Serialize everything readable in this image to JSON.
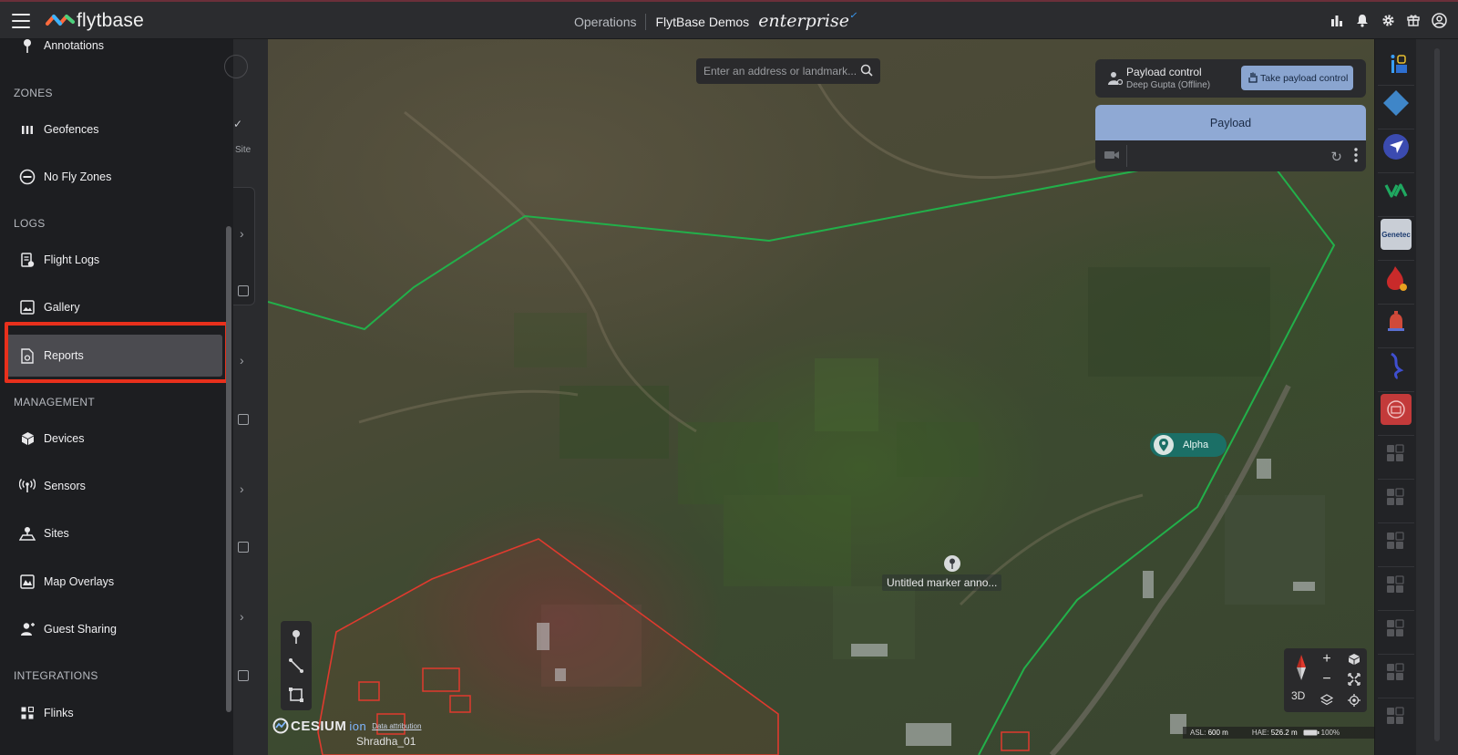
{
  "topbar": {
    "brand": "flytbase",
    "nav_operations": "Operations",
    "organization": "FlytBase Demos",
    "edition": "enterprise",
    "icons": [
      "analytics-icon",
      "bell-icon",
      "gear-icon",
      "gift-icon",
      "user-avatar-icon"
    ]
  },
  "sidebar": {
    "top_item": "Annotations",
    "sections": {
      "zones": "ZONES",
      "logs": "LOGS",
      "management": "MANAGEMENT",
      "integrations": "INTEGRATIONS"
    },
    "items": {
      "geofences": "Geofences",
      "no_fly_zones": "No Fly Zones",
      "flight_logs": "Flight Logs",
      "gallery": "Gallery",
      "reports": "Reports",
      "devices": "Devices",
      "sensors": "Sensors",
      "sites": "Sites",
      "map_overlays": "Map Overlays",
      "guest_sharing": "Guest Sharing",
      "flinks": "Flinks"
    },
    "active_item": "Reports"
  },
  "behind_panel": {
    "site_label": "Site"
  },
  "map": {
    "search_placeholder": "Enter an address or landmark...",
    "alpha_label": "Alpha",
    "marker_label": "Untitled marker anno...",
    "site_name": "Shradha_01",
    "cesium": "CESIUM",
    "cesium_ion": "ion",
    "data_attribution": "Data attribution",
    "view_mode": "3D",
    "status": {
      "asl_label": "ASL:",
      "asl_value": "600 m",
      "hae_label": "HAE:",
      "hae_value": "526.2 m",
      "battery": "100%"
    },
    "geofence_color": "#22b04a",
    "nofly_color": "#e03a2e"
  },
  "payload_control": {
    "title": "Payload control",
    "operator": "Deep Gupta (Offline)",
    "take_button": "Take payload control"
  },
  "payload_panel": {
    "title": "Payload"
  },
  "rail": {
    "apps": [
      "info-app-icon",
      "diamond-app-icon",
      "send-app-icon",
      "va-app-icon",
      "genetec-app-icon",
      "flame-app-icon",
      "alarm-app-icon",
      "dna-app-icon",
      "gateway-app-icon"
    ],
    "genetec_label": "Genetec"
  },
  "colors": {
    "accent": "#8fa9d4",
    "highlight_box": "#e8301c",
    "alpha_chip": "#1b6f66"
  }
}
